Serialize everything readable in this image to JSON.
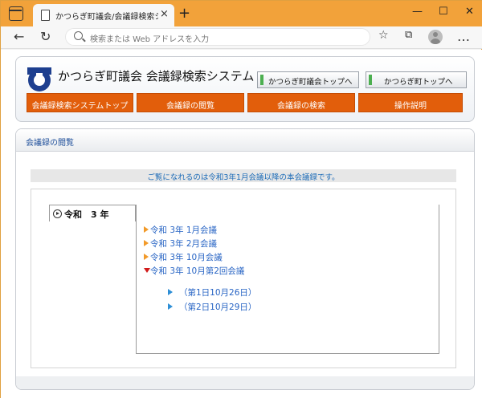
{
  "browser": {
    "tab_title": "かつらぎ町議会/会議録検索システム",
    "tab_close": "×",
    "new_tab": "+",
    "address_placeholder": "検索または Web アドレスを入力",
    "window_controls": {
      "minimize": "—",
      "maximize": "☐",
      "close": "✕"
    },
    "nav": {
      "back": "←",
      "reload": "↻",
      "favorites": "☆",
      "collections": "⧉",
      "more": "…"
    }
  },
  "header": {
    "site_title": "かつらぎ町議会 会議録検索システム",
    "top_links": [
      "かつらぎ町議会トップへ",
      "かつらぎ町トップへ"
    ],
    "nav_items": [
      "会議録検索システムトップ",
      "会議録の閲覧",
      "会議録の検索",
      "操作説明"
    ]
  },
  "content": {
    "panel_title": "会議録の閲覧",
    "notice": "ご覧になれるのは令和3年1月会議以降の本会議録です。",
    "year_label": "令和　3 年",
    "meetings": [
      "令和 3年 1月会議",
      "令和 3年 2月会議",
      "令和 3年 10月会議",
      "令和 3年 10月第2回会議"
    ],
    "sessions": [
      "（第1日10月26日）",
      "（第2日10月29日）"
    ]
  },
  "colors": {
    "accent_orange": "#e25e0b",
    "link_blue": "#2764c4",
    "browser_frame": "#f2a23a"
  }
}
